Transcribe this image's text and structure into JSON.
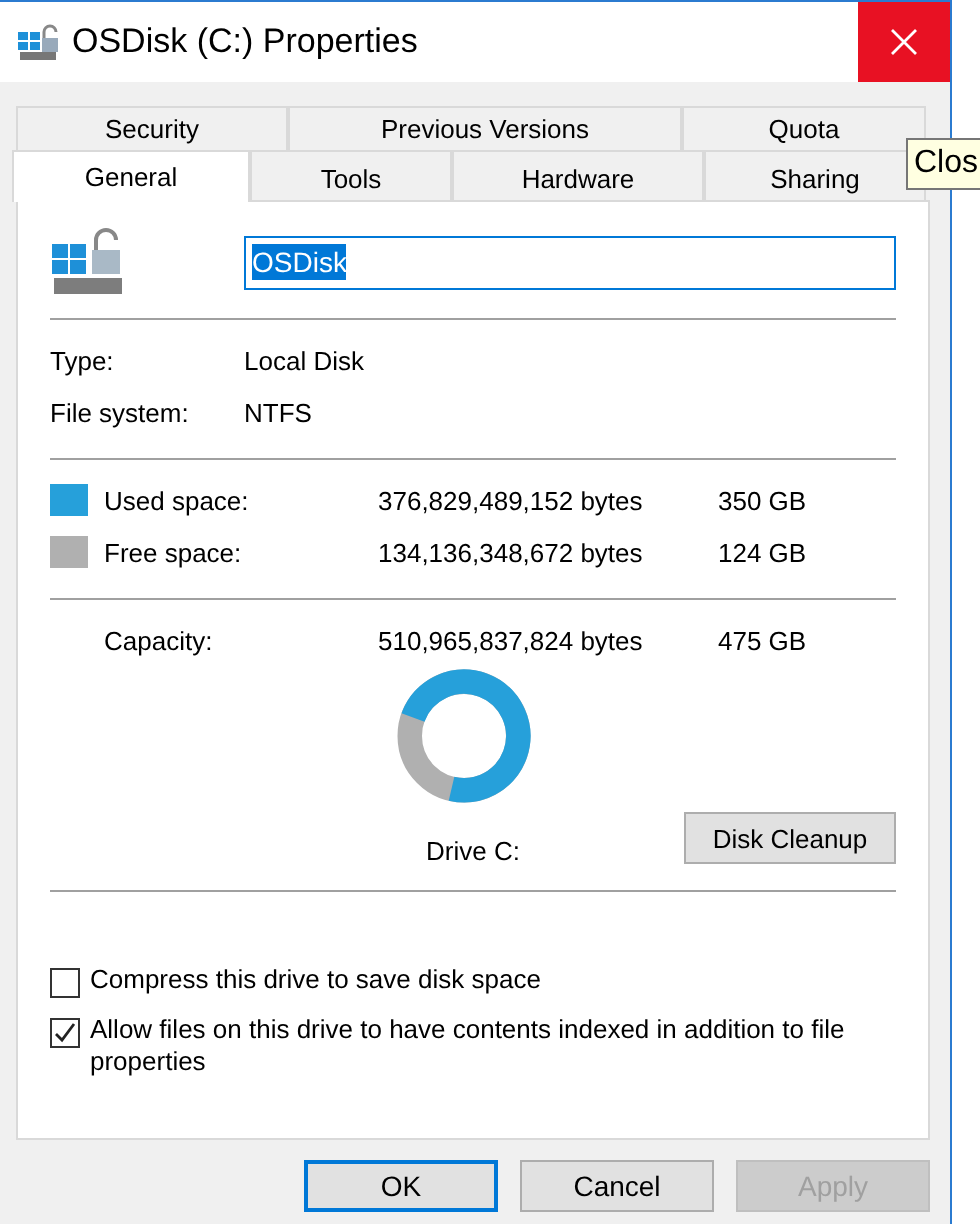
{
  "window": {
    "title": "OSDisk (C:) Properties",
    "tooltip": "Clos"
  },
  "tab_rows": [
    [
      {
        "label": "Security",
        "selected": false
      },
      {
        "label": "Previous Versions",
        "selected": false
      },
      {
        "label": "Quota",
        "selected": false
      }
    ],
    [
      {
        "label": "General",
        "selected": true
      },
      {
        "label": "Tools",
        "selected": false
      },
      {
        "label": "Hardware",
        "selected": false
      },
      {
        "label": "Sharing",
        "selected": false
      }
    ]
  ],
  "drive": {
    "name": "OSDisk",
    "info": [
      {
        "label": "Type:",
        "value": "Local Disk"
      },
      {
        "label": "File system:",
        "value": "NTFS"
      }
    ]
  },
  "space": [
    {
      "label": "Used space:",
      "bytes": "376,829,489,152 bytes",
      "size": "350 GB",
      "color": "#26a0da"
    },
    {
      "label": "Free space:",
      "bytes": "134,136,348,672 bytes",
      "size": "124 GB",
      "color": "#b0b0b0"
    }
  ],
  "capacity": {
    "label": "Capacity:",
    "bytes": "510,965,837,824 bytes",
    "size": "475 GB"
  },
  "drive_label": "Drive C:",
  "cleanup_button": "Disk Cleanup",
  "options": [
    {
      "label": "Compress this drive to save disk space",
      "checked": false
    },
    {
      "label": "Allow files on this drive to have contents indexed in addition to file properties",
      "checked": true
    }
  ],
  "buttons": [
    {
      "label": "OK",
      "default": true,
      "disabled": false
    },
    {
      "label": "Cancel",
      "default": false,
      "disabled": false
    },
    {
      "label": "Apply",
      "default": false,
      "disabled": true
    }
  ]
}
